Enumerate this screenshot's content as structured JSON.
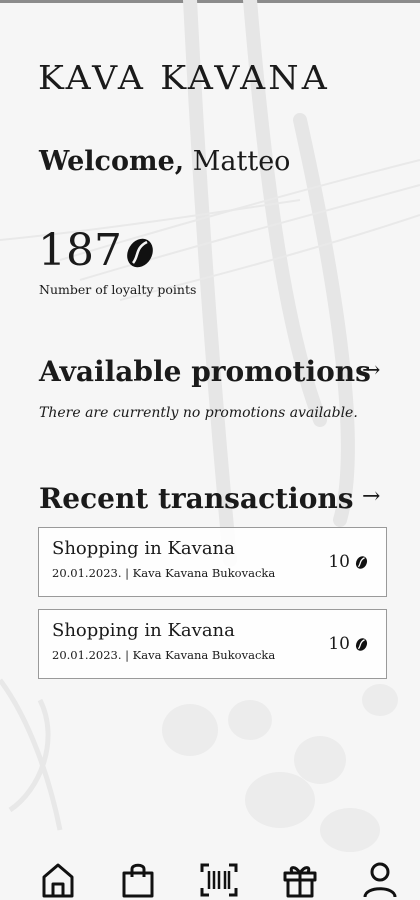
{
  "brand": {
    "logo": "KAVA KAVANA"
  },
  "welcome": {
    "greeting": "Welcome,",
    "name": "Matteo"
  },
  "loyalty": {
    "points": "187",
    "label": "Number of loyalty points",
    "icon": "coffee-bean-icon"
  },
  "promotions": {
    "title": "Available promotions",
    "empty_text": "There are currently no promotions available."
  },
  "transactions": {
    "title": "Recent transactions",
    "items": [
      {
        "title": "Shopping in Kavana",
        "meta": "20.01.2023. | Kava Kavana Bukovacka",
        "points": "10"
      },
      {
        "title": "Shopping in Kavana",
        "meta": "20.01.2023. | Kava Kavana Bukovacka",
        "points": "10"
      }
    ]
  },
  "nav": {
    "items": [
      "home-icon",
      "shopping-bag-icon",
      "barcode-scan-icon",
      "gift-icon",
      "user-icon"
    ]
  }
}
